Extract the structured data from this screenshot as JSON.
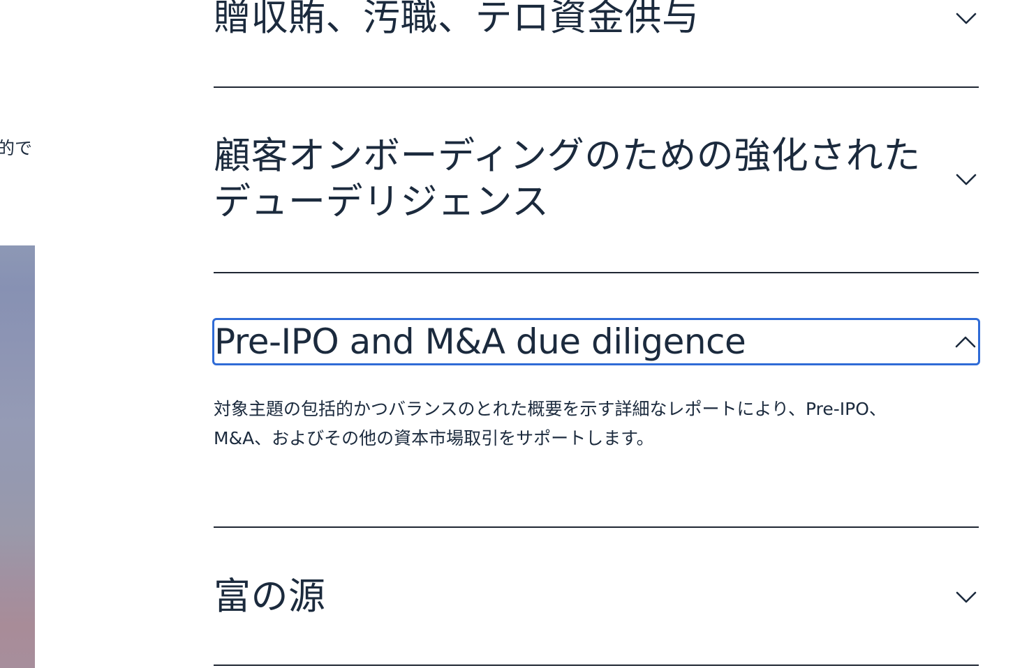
{
  "left_fragment": {
    "text": "的で"
  },
  "accordion": {
    "items": [
      {
        "title": "贈収賄、汚職、テロ資金供与",
        "expanded": false,
        "icon": "chevron-down-icon"
      },
      {
        "title": "顧客オンボーディングのための強化されたデューデリジェンス",
        "expanded": false,
        "icon": "chevron-down-icon"
      },
      {
        "title": "Pre-IPO and M&A due diligence",
        "expanded": true,
        "icon": "chevron-up-icon",
        "body": "対象主題の包括的かつバランスのとれた概要を示す詳細なレポートにより、Pre-IPO、M&A、およびその他の資本市場取引をサポートします。"
      },
      {
        "title": "富の源",
        "expanded": false,
        "icon": "chevron-down-icon"
      }
    ]
  },
  "colors": {
    "text": "#1b2a3d",
    "divider": "#1f2733",
    "focus_ring": "#2f6bd6"
  }
}
